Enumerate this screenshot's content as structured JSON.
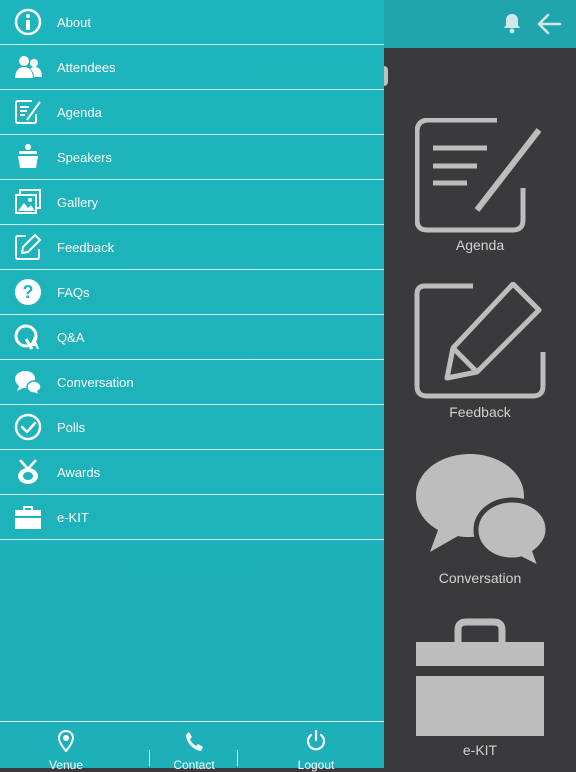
{
  "header": {
    "bell_icon": "bell-icon",
    "back_icon": "arrow-left-icon"
  },
  "menu": {
    "items": [
      {
        "label": "About",
        "icon": "info-icon"
      },
      {
        "label": "Attendees",
        "icon": "people-icon"
      },
      {
        "label": "Agenda",
        "icon": "agenda-icon"
      },
      {
        "label": "Speakers",
        "icon": "speaker-icon"
      },
      {
        "label": "Gallery",
        "icon": "gallery-icon"
      },
      {
        "label": "Feedback",
        "icon": "feedback-icon"
      },
      {
        "label": "FAQs",
        "icon": "question-icon"
      },
      {
        "label": "Q&A",
        "icon": "qa-icon"
      },
      {
        "label": "Conversation",
        "icon": "chat-icon"
      },
      {
        "label": "Polls",
        "icon": "check-circle-icon"
      },
      {
        "label": "Awards",
        "icon": "award-icon"
      },
      {
        "label": "e-KIT",
        "icon": "briefcase-icon"
      }
    ]
  },
  "bottom_bar": {
    "venue": "Venue",
    "contact": "Contact",
    "logout": "Logout"
  },
  "tiles": [
    {
      "label": "Agenda"
    },
    {
      "label": "Feedback"
    },
    {
      "label": "Conversation"
    },
    {
      "label": "e-KIT"
    }
  ],
  "colors": {
    "drawer": "#1db5bd",
    "header": "#21a5ad",
    "background": "#3a3a3c",
    "tile_icon": "#bdbdbd"
  }
}
